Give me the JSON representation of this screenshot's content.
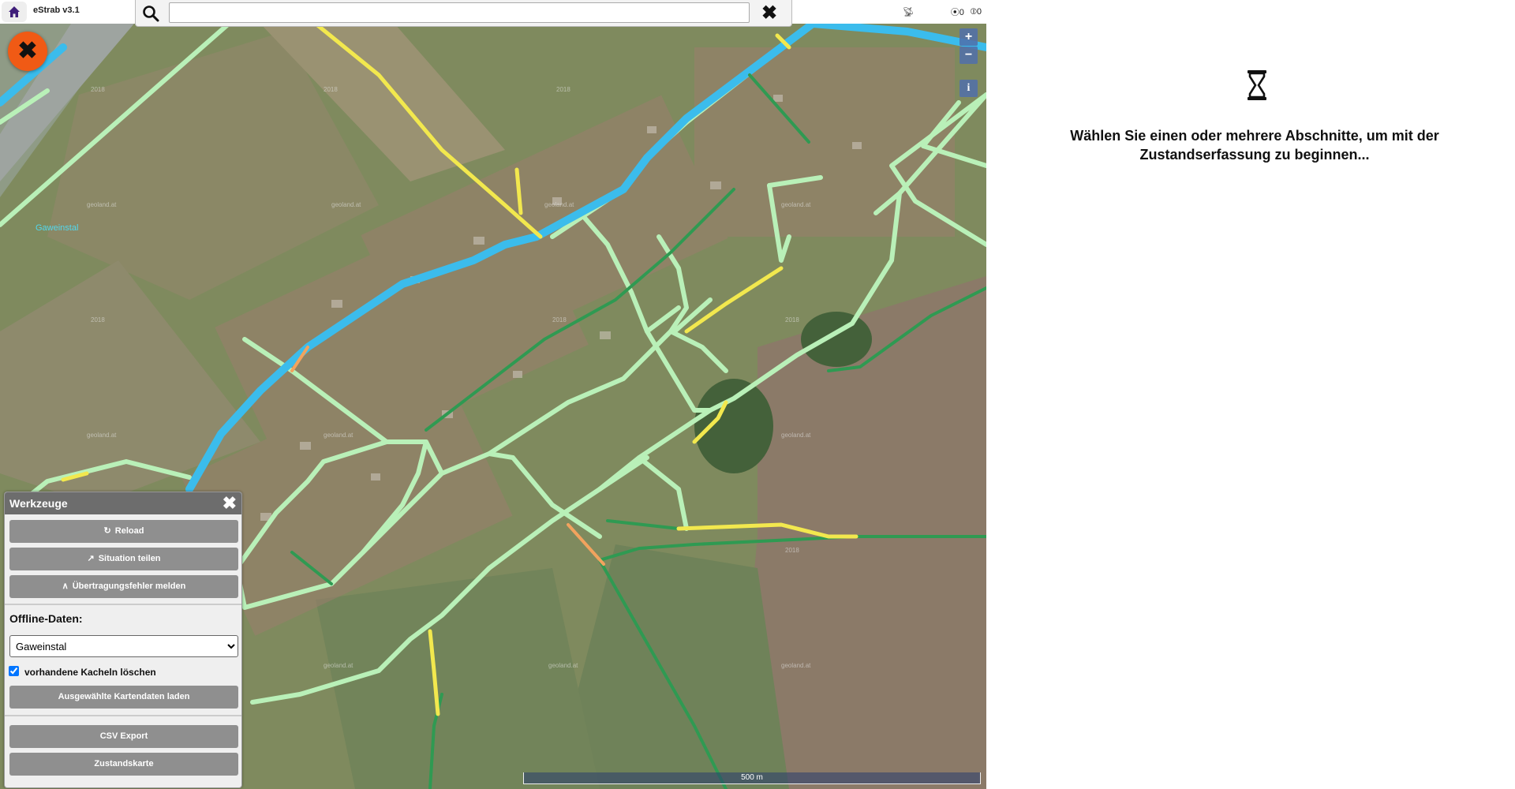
{
  "app": {
    "title": "eStrab v3.1"
  },
  "search": {
    "placeholder": "",
    "value": ""
  },
  "status": {
    "counter_a": "0",
    "counter_b": "0"
  },
  "map": {
    "place_label": "Gaweinstal",
    "scale_label": "500 m",
    "watermark": "geoland.at",
    "year_label": "2018"
  },
  "tools": {
    "title": "Werkzeuge",
    "reload": "Reload",
    "share": "Situation teilen",
    "report": "Übertragungsfehler melden",
    "offline_label": "Offline-Daten:",
    "offline_selected": "Gaweinstal",
    "delete_tiles_label": "vorhandene Kacheln löschen",
    "delete_tiles_checked": true,
    "load_button": "Ausgewählte Kartendaten laden",
    "csv_export": "CSV Export",
    "condition_map": "Zustandskarte"
  },
  "message": {
    "text": "Wählen Sie einen oder mehrere Abschnitte, um mit der Zustandserfassung zu beginnen..."
  },
  "colors": {
    "road_blue": "#3bbcec",
    "road_lightgreen": "#b9f0b8",
    "road_yellow": "#f2e84e",
    "road_darkgreen": "#2f9a52",
    "road_orange": "#f2a35e",
    "fab_orange": "#f05a15"
  }
}
